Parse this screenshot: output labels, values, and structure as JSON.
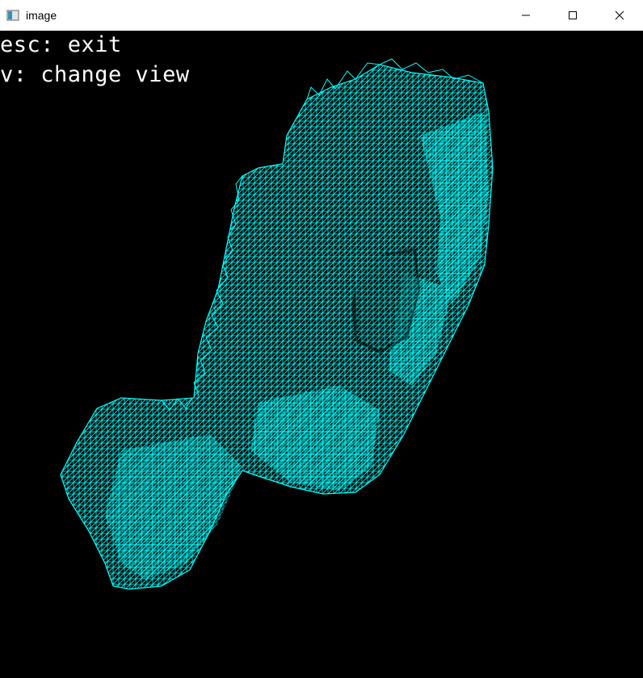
{
  "window": {
    "title": "image",
    "icon": "image-window-icon",
    "controls": [
      "minimize",
      "maximize",
      "close"
    ]
  },
  "overlay": {
    "line1": "esc: exit",
    "line2": "v: change view"
  },
  "colors": {
    "background": "#000000",
    "mesh": "#00ffff",
    "overlay_text": "#ffffff",
    "titlebar": "#ffffff"
  }
}
